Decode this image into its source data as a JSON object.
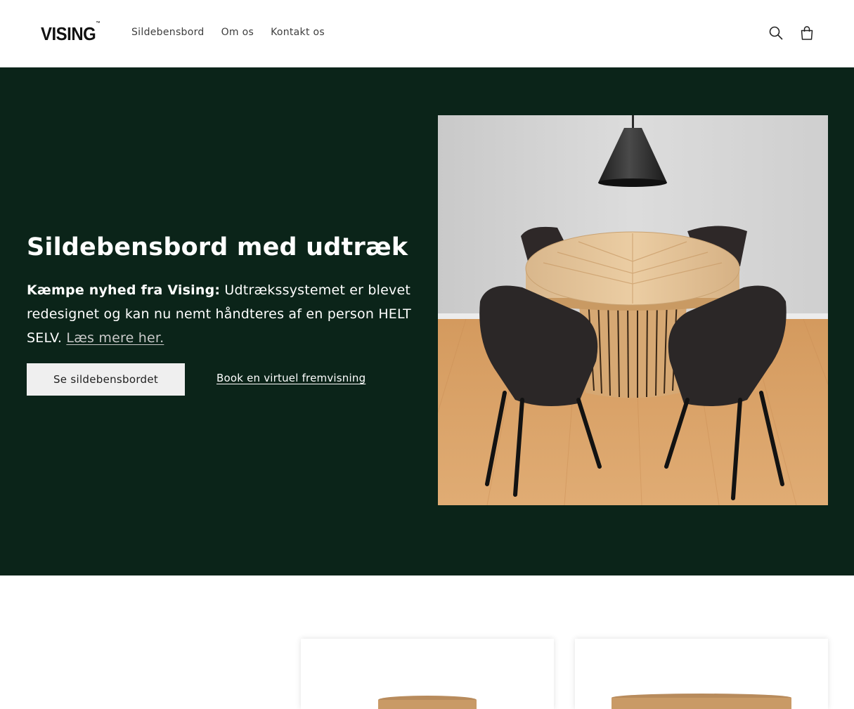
{
  "header": {
    "logo": "VISING",
    "logo_tm": "™",
    "nav": [
      {
        "label": "Sildebensbord"
      },
      {
        "label": "Om os"
      },
      {
        "label": "Kontakt os"
      }
    ],
    "icons": [
      "search-icon",
      "cart-icon"
    ]
  },
  "hero": {
    "title": "Sildebensbord med udtræk",
    "text_bold": "Kæmpe nyhed fra Vising:",
    "text_body": " Udtrækssystemet er blevet redesignet og kan nu nemt håndteres af en person HELT SELV. ",
    "text_link": "Læs mere her. ",
    "primary_button": "Se sildebensbordet",
    "secondary_link": "Book en virtuel fremvisning",
    "background_color": "#0b2419"
  },
  "products": {
    "cards": [
      {
        "image": "round-table-top-1"
      },
      {
        "image": "round-table-top-2"
      }
    ]
  }
}
